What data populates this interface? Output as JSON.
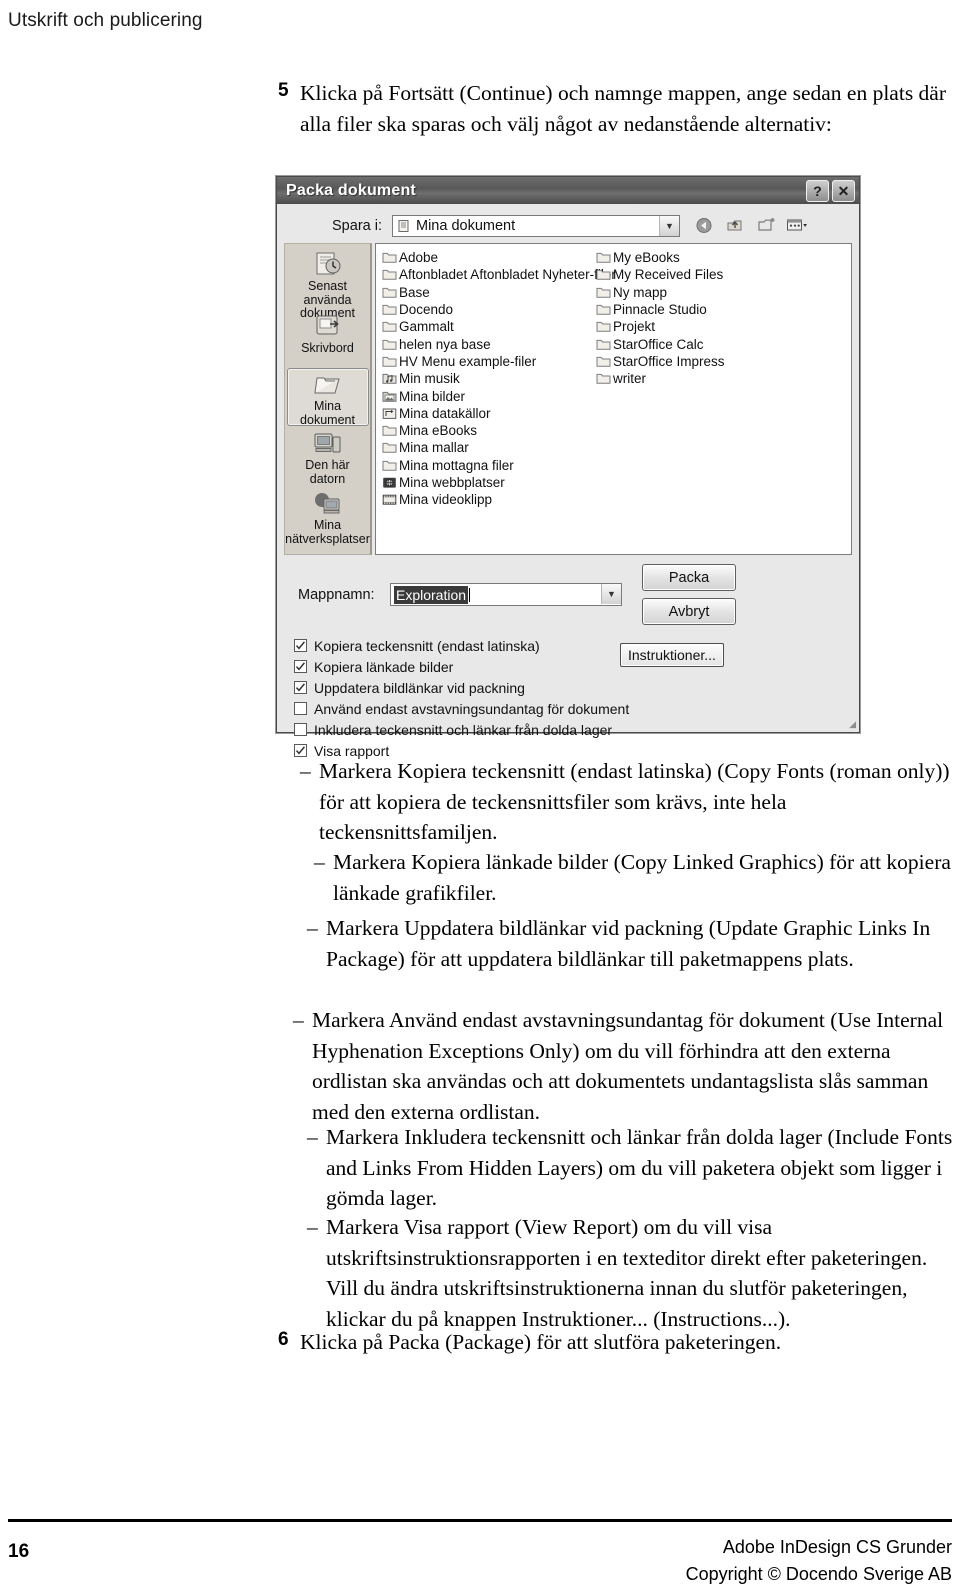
{
  "running_head": "Utskrift och publicering",
  "step5": {
    "number": "5",
    "parts": [
      {
        "t": "Klicka på ",
        "b": false
      },
      {
        "t": "Fortsätt",
        "b": true
      },
      {
        "t": " (Continue) och namnge mappen, ange sedan en plats där alla filer ska sparas och välj något av nedanstående alternativ:",
        "b": false
      }
    ]
  },
  "step6": {
    "number": "6",
    "parts": [
      {
        "t": "Klicka på ",
        "b": false
      },
      {
        "t": "Packa",
        "b": true
      },
      {
        "t": " (Package) för att slutföra paketeringen.",
        "b": false
      }
    ]
  },
  "bullets": [
    {
      "dash": "–",
      "parts": [
        {
          "t": "Markera ",
          "b": false
        },
        {
          "t": "Kopiera teckensnitt (endast latinska)",
          "b": true
        },
        {
          "t": " (Copy Fonts (roman only)) för att kopiera de teckensnittsfiler som krävs, inte hela teckensnittsfamiljen.",
          "b": false
        }
      ]
    },
    {
      "dash": "–",
      "parts": [
        {
          "t": "Markera ",
          "b": false
        },
        {
          "t": "Kopiera länkade bilder",
          "b": true
        },
        {
          "t": " (Copy Linked Graphics) för att kopiera länkade grafikfiler.",
          "b": false
        }
      ]
    },
    {
      "dash": "–",
      "parts": [
        {
          "t": "Markera ",
          "b": false
        },
        {
          "t": "Uppdatera bildlänkar vid packning",
          "b": true
        },
        {
          "t": " (Update Graphic Links In Package) för att uppdatera bildlänkar till paketmappens plats.",
          "b": false
        }
      ]
    },
    {
      "dash": "–",
      "parts": [
        {
          "t": "Markera ",
          "b": false
        },
        {
          "t": "Använd endast avstavningsundantag för dokument",
          "b": true
        },
        {
          "t": " (Use Internal Hyphenation Exceptions Only) om du vill förhindra att den externa ordlistan ska användas och att dokumentets undantagslista slås samman med den externa ordlistan.",
          "b": false
        }
      ]
    },
    {
      "dash": "–",
      "parts": [
        {
          "t": "Markera ",
          "b": false
        },
        {
          "t": "Inkludera teckensnitt och länkar från dolda lager",
          "b": true
        },
        {
          "t": " (Include Fonts and Links From Hidden Layers) om du vill paketera objekt som ligger i gömda lager.",
          "b": false
        }
      ]
    },
    {
      "dash": "–",
      "parts": [
        {
          "t": "Markera ",
          "b": false
        },
        {
          "t": "Visa rapport",
          "b": true
        },
        {
          "t": " (View Report) om du vill visa utskriftsinstruktionsrapporten i en texteditor direkt efter paketeringen. Vill du ändra utskriftsinstruktionerna innan du slutför paketeringen, klickar du på knappen ",
          "b": false
        },
        {
          "t": "Instruktioner...",
          "b": true
        },
        {
          "t": " (Instructions...).",
          "b": false
        }
      ]
    }
  ],
  "dialog": {
    "title": "Packa dokument",
    "help_button": "?",
    "close_button": "✕",
    "save_in_label": "Spara i:",
    "save_in_value": "Mina dokument",
    "toolbar_icons": [
      "back-icon",
      "up-folder-icon",
      "new-folder-icon",
      "views-icon"
    ],
    "places": [
      {
        "label": "Senast använda dokument",
        "icon": "recent-documents-icon",
        "selected": false
      },
      {
        "label": "Skrivbord",
        "icon": "desktop-icon",
        "selected": false
      },
      {
        "label": "Mina dokument",
        "icon": "my-documents-icon",
        "selected": true
      },
      {
        "label": "Den här datorn",
        "icon": "my-computer-icon",
        "selected": false
      },
      {
        "label": "Mina nätverksplatser",
        "icon": "network-places-icon",
        "selected": false
      }
    ],
    "files_column1": [
      {
        "name": "Adobe",
        "icon": "folder-icon"
      },
      {
        "name": "Aftonbladet Aftonbladet Nyheter-filer",
        "icon": "folder-icon"
      },
      {
        "name": "Base",
        "icon": "folder-icon"
      },
      {
        "name": "Docendo",
        "icon": "folder-icon"
      },
      {
        "name": "Gammalt",
        "icon": "folder-icon"
      },
      {
        "name": "helen nya base",
        "icon": "folder-icon"
      },
      {
        "name": "HV Menu example-filer",
        "icon": "folder-icon"
      },
      {
        "name": "Min musik",
        "icon": "music-folder-icon"
      },
      {
        "name": "Mina bilder",
        "icon": "pictures-folder-icon"
      },
      {
        "name": "Mina datakällor",
        "icon": "data-sources-folder-icon"
      },
      {
        "name": "Mina eBooks",
        "icon": "folder-icon"
      },
      {
        "name": "Mina mallar",
        "icon": "folder-icon"
      },
      {
        "name": "Mina mottagna filer",
        "icon": "folder-icon"
      },
      {
        "name": "Mina webbplatser",
        "icon": "web-folder-icon"
      },
      {
        "name": "Mina videoklipp",
        "icon": "video-folder-icon"
      }
    ],
    "files_column2": [
      {
        "name": "My eBooks",
        "icon": "folder-icon"
      },
      {
        "name": "My Received Files",
        "icon": "folder-icon"
      },
      {
        "name": "Ny mapp",
        "icon": "folder-icon"
      },
      {
        "name": "Pinnacle Studio",
        "icon": "folder-icon"
      },
      {
        "name": "Projekt",
        "icon": "folder-icon"
      },
      {
        "name": "StarOffice Calc",
        "icon": "folder-icon"
      },
      {
        "name": "StarOffice Impress",
        "icon": "folder-icon"
      },
      {
        "name": "writer",
        "icon": "folder-icon"
      }
    ],
    "folder_name_label": "Mappnamn:",
    "folder_name_value": "Exploration",
    "primary_button": "Packa",
    "cancel_button": "Avbryt",
    "instructions_button": "Instruktioner...",
    "checkboxes": [
      {
        "label": "Kopiera teckensnitt (endast latinska)",
        "checked": true
      },
      {
        "label": "Kopiera länkade bilder",
        "checked": true
      },
      {
        "label": "Uppdatera bildlänkar vid packning",
        "checked": true
      },
      {
        "label": "Använd endast avstavningsundantag för dokument",
        "checked": false
      },
      {
        "label": "Inkludera teckensnitt och länkar från dolda lager",
        "checked": false
      },
      {
        "label": "Visa rapport",
        "checked": true
      }
    ]
  },
  "footer": {
    "page_number": "16",
    "book_title": "Adobe InDesign CS Grunder",
    "copyright": "Copyright © Docendo Sverige AB"
  }
}
